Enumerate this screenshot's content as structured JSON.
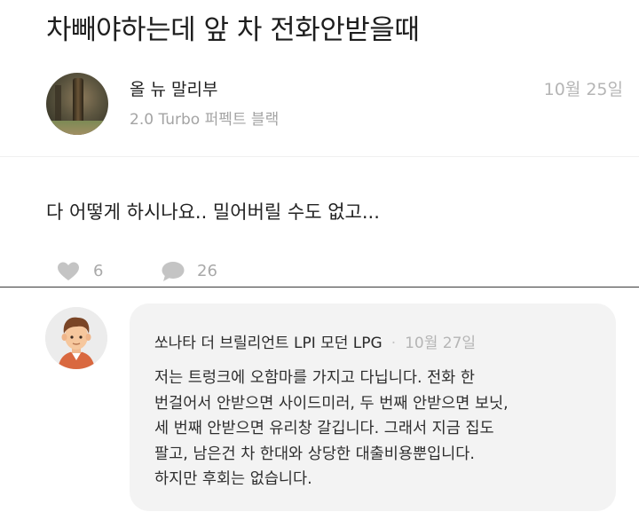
{
  "post": {
    "title": "차빼야하는데 앞 차 전화안받을때",
    "author": {
      "name": "올 뉴 말리부",
      "car": "2.0 Turbo 퍼펙트 블랙"
    },
    "date": "10월 25일",
    "body": "다 어떻게 하시나요.. 밀어버릴 수도 없고...",
    "likes": "6",
    "comments": "26"
  },
  "comment": {
    "author": "쏘나타 더 브릴리언트 LPI 모던 LPG",
    "separator": "·",
    "date": "10월 27일",
    "lines": [
      "저는 트렁크에 오함마를 가지고 다닙니다. 전화 한",
      "번걸어서 안받으면 사이드미러, 두 번째 안받으면 보닛,",
      "세 번째 안받으면 유리창 갈깁니다. 그래서 지금 집도",
      "팔고, 남은건 차 한대와 상당한 대출비용뿐입니다.",
      "하지만 후회는 없습니다."
    ]
  },
  "icons": {
    "heart": "heart-icon",
    "comment": "speech-bubble-icon"
  },
  "colors": {
    "icon_gray": "#c4c4c4",
    "bubble_bg": "#f3f3f3",
    "muted_text": "#a4a4a4"
  }
}
